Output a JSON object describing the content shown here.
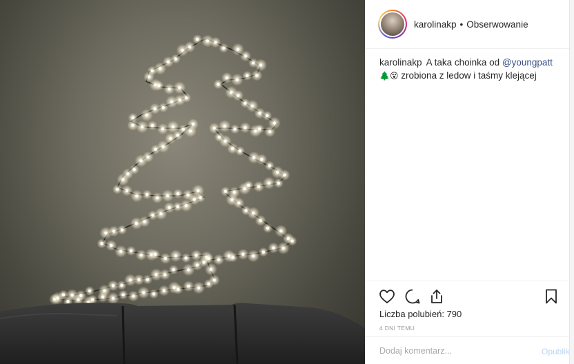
{
  "post": {
    "username": "karolinakp",
    "separator": "•",
    "follow_label": "Obserwowanie",
    "caption_user": "karolinakp",
    "caption_text_1": "A taka choinka od",
    "mention": "@youngpatt",
    "caption_emoji": "🌲😵",
    "caption_text_2": "zrobiona z ledow i taśmy klejącej",
    "likes_text": "Liczba polubień: 790",
    "time_text": "4 DNI TEMU",
    "comment_placeholder": "Dodaj komentarz...",
    "post_label": "Opublikuj"
  },
  "icons": {
    "like": "heart-icon",
    "comment": "comment-icon",
    "share": "share-icon",
    "save": "bookmark-icon"
  },
  "colors": {
    "mention": "#385185",
    "divider": "#efefef",
    "muted": "#999999"
  }
}
